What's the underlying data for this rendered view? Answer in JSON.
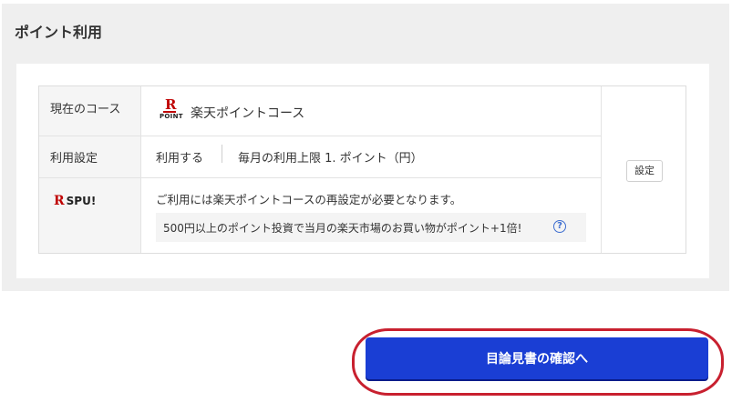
{
  "section": {
    "title": "ポイント利用"
  },
  "course": {
    "label": "現在のコース",
    "logo_letter": "R",
    "logo_text": "POINT",
    "value": "楽天ポイントコース"
  },
  "usage": {
    "label": "利用設定",
    "mode": "利用する",
    "limit_text": "毎月の利用上限 1. ポイント（円）"
  },
  "spu": {
    "logo_letter": "R",
    "logo_text": "SPU!",
    "notice": "ご利用には楽天ポイントコースの再設定が必要となります。",
    "info": "500円以上のポイント投資で当月の楽天市場のお買い物がポイント+1倍!",
    "help_glyph": "?"
  },
  "buttons": {
    "setting": "設定",
    "confirm": "目論見書の確認へ"
  },
  "colors": {
    "brand_red": "#bf0000",
    "confirm_blue": "#1a3ed4",
    "annotation_red": "#c8202f"
  }
}
